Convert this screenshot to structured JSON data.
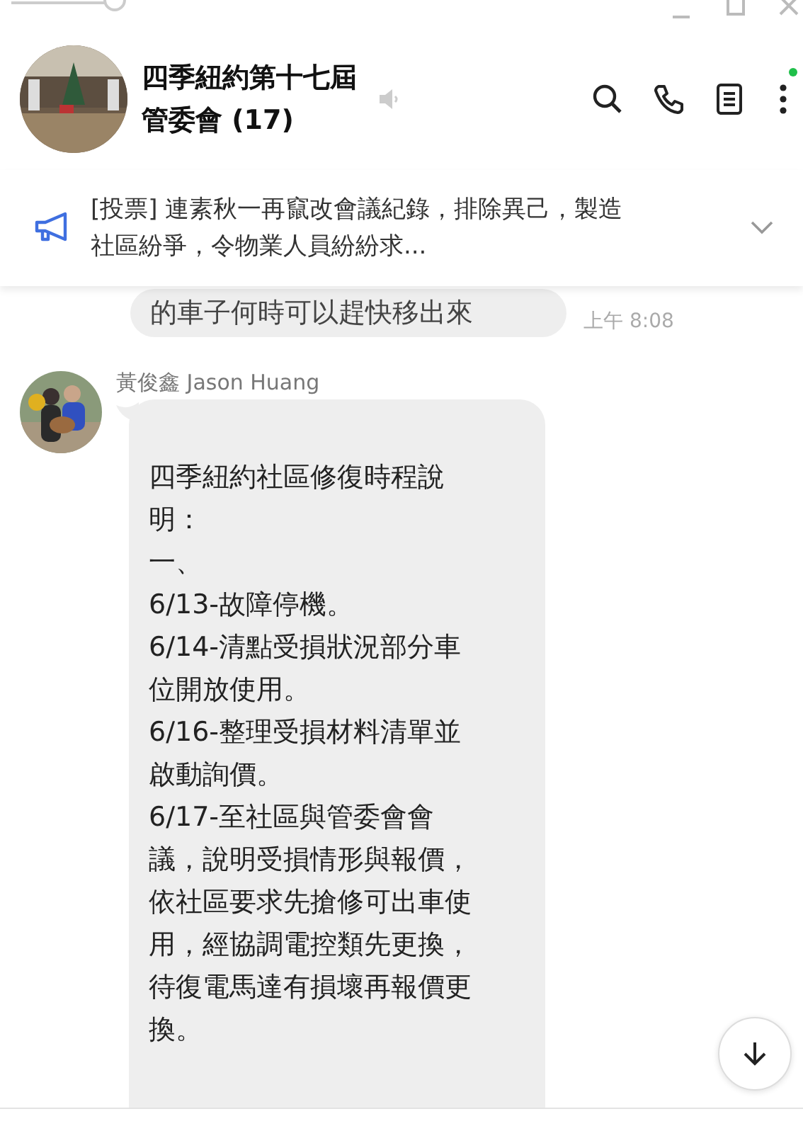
{
  "zoom_slider": {
    "level": 1
  },
  "header": {
    "title_lines": [
      "四季紐約第十七屆",
      "管委會 (17)"
    ],
    "muted": true,
    "online": true
  },
  "announcement": {
    "lines": [
      "[投票] 連素秋一再竄改會議紀錄，排除異己，製造",
      "社區紛爭，令物業人員紛紛求..."
    ]
  },
  "messages": [
    {
      "kind": "partial",
      "text": "的車子何時可以趕快移出來",
      "time": "上午 8:08"
    },
    {
      "kind": "incoming",
      "sender": "黃俊鑫 Jason Huang",
      "lines": [
        "四季紐約社區修復時程說",
        "明：",
        "一、",
        "6/13-故障停機。",
        "6/14-清點受損狀況部分車",
        "位開放使用。",
        "6/16-整理受損材料清單並",
        "啟動詢價。",
        "6/17-至社區與管委會會",
        "議，說明受損情形與報價，",
        "依社區要求先搶修可出車使",
        "用，經協調電控類先更換，",
        "待復電馬達有損壞再報價更",
        "換。"
      ]
    }
  ]
}
